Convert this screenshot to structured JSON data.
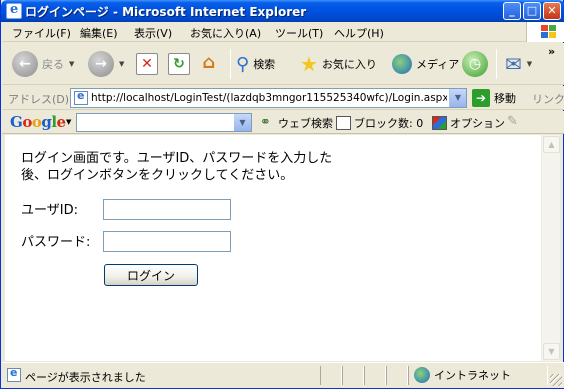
{
  "window": {
    "title": "ログインページ - Microsoft Internet Explorer",
    "title_buttons": [
      "minimize-icon",
      "maximize-icon",
      "close-icon"
    ]
  },
  "menu": {
    "items": [
      "ファイル(F)",
      "編集(E)",
      "表示(V)",
      "お気に入り(A)",
      "ツール(T)",
      "ヘルプ(H)"
    ]
  },
  "toolbar": {
    "back_label": "戻る",
    "search_label": "検索",
    "favorites_label": "お気に入り",
    "media_label": "メディア"
  },
  "address": {
    "label": "アドレス(D)",
    "url": "http://localhost/LoginTest/(lazdqb3mngor115525340wfc)/Login.aspx",
    "go_label": "移動",
    "links_label": "リンク"
  },
  "google": {
    "logo": "Google",
    "search_value": "",
    "web_search_label": "ウェブ検索",
    "popup_block_label": "ブロック数: 0",
    "options_label": "オプション"
  },
  "page": {
    "intro": "ログイン画面です。ユーザID、パスワードを入力した後、ログインボタンをクリックしてください。",
    "user_label": "ユーザID:",
    "user_value": "",
    "password_label": "パスワード:",
    "password_value": "",
    "login_button": "ログイン"
  },
  "status": {
    "text": "ページが表示されました",
    "zone": "イントラネット"
  },
  "colors": {
    "titlebar": "#0054e3",
    "chrome": "#ece9d8",
    "input_border": "#7f9db9"
  }
}
